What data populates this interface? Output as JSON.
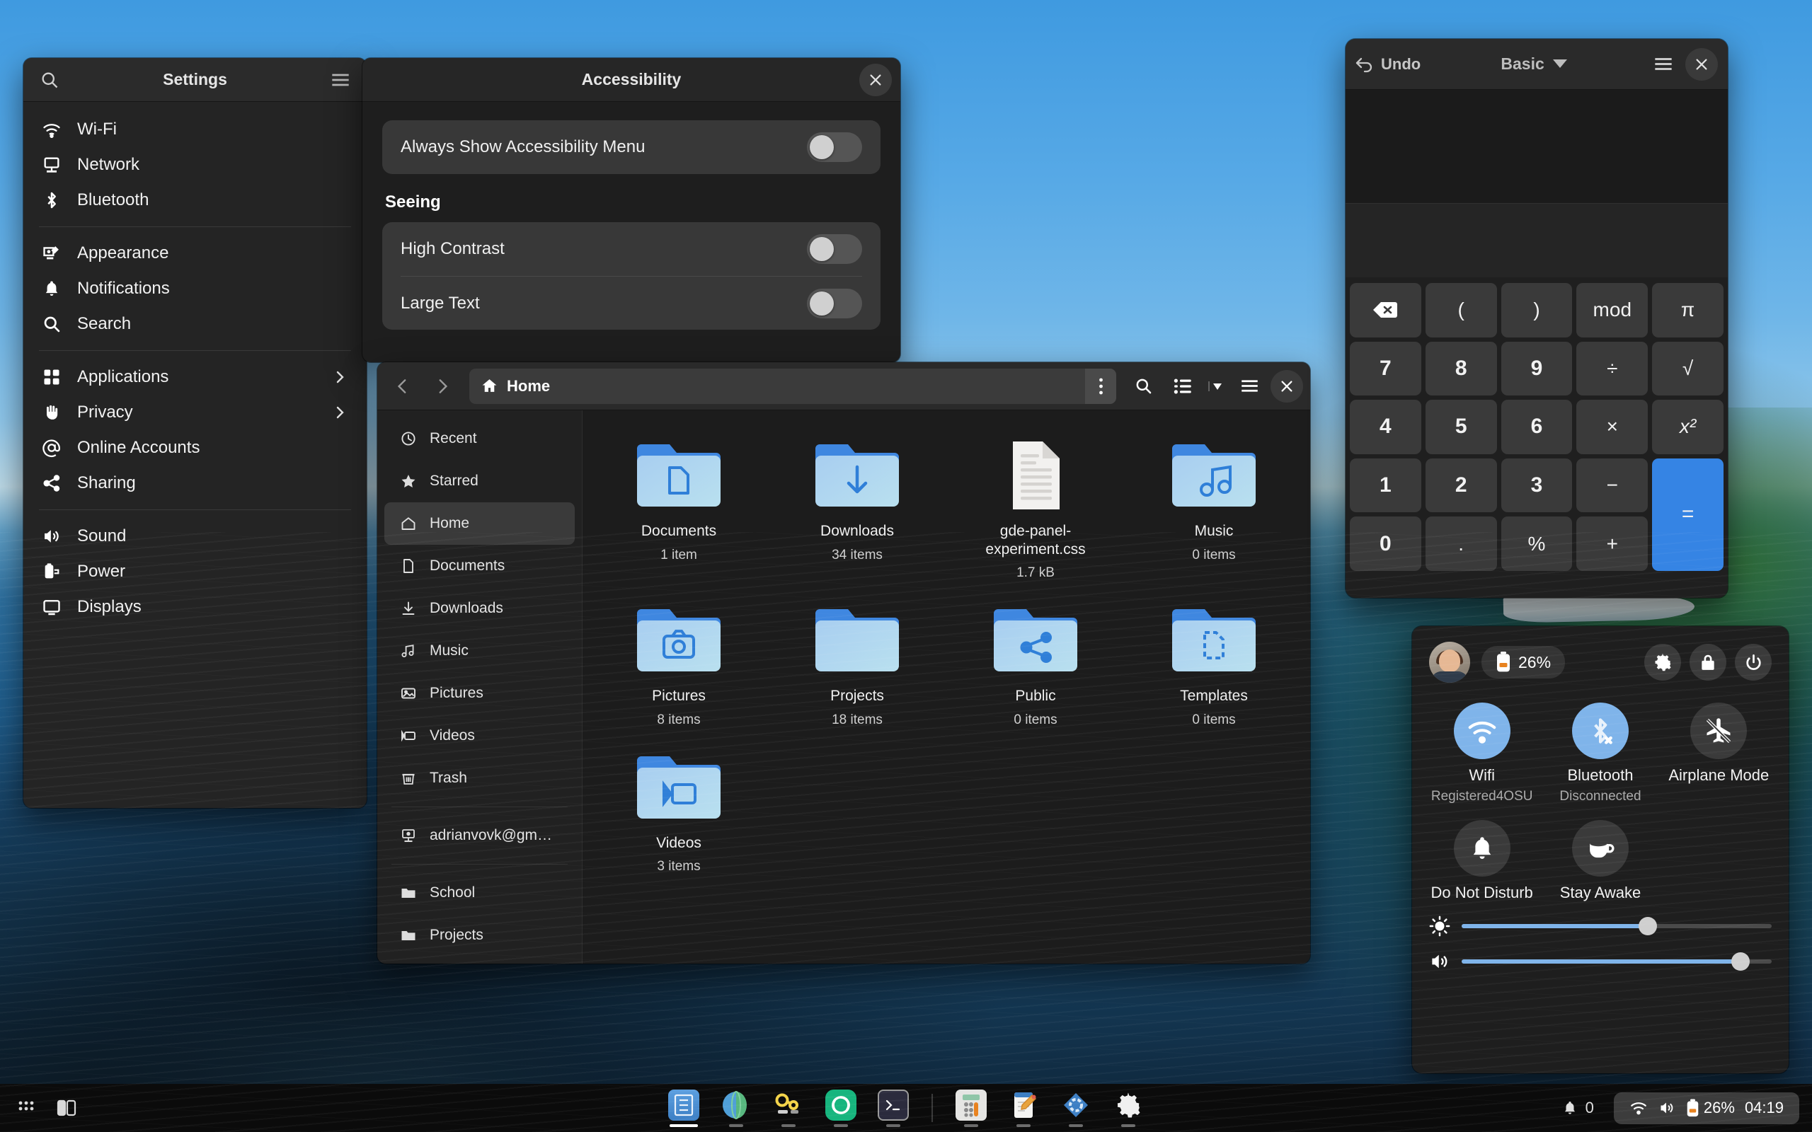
{
  "settings": {
    "title": "Settings",
    "search_icon": "search-icon",
    "menu_icon": "hamburger-menu-icon",
    "groups": [
      {
        "items": [
          {
            "label": "Wi-Fi",
            "icon": "wifi-icon"
          },
          {
            "label": "Network",
            "icon": "network-icon"
          },
          {
            "label": "Bluetooth",
            "icon": "bluetooth-icon"
          }
        ]
      },
      {
        "items": [
          {
            "label": "Appearance",
            "icon": "appearance-icon"
          },
          {
            "label": "Notifications",
            "icon": "bell-icon"
          },
          {
            "label": "Search",
            "icon": "search-icon"
          }
        ]
      },
      {
        "items": [
          {
            "label": "Applications",
            "icon": "applications-grid-icon",
            "chevron": "›"
          },
          {
            "label": "Privacy",
            "icon": "hand-icon",
            "chevron": "›"
          },
          {
            "label": "Online Accounts",
            "icon": "at-sign-icon"
          },
          {
            "label": "Sharing",
            "icon": "share-icon"
          }
        ]
      },
      {
        "items": [
          {
            "label": "Sound",
            "icon": "speaker-icon"
          },
          {
            "label": "Power",
            "icon": "battery-plug-icon"
          },
          {
            "label": "Displays",
            "icon": "display-icon"
          }
        ]
      }
    ]
  },
  "accessibility": {
    "title": "Accessibility",
    "close_icon": "close-icon",
    "rows_top": [
      {
        "label": "Always Show Accessibility Menu",
        "toggle": "off"
      }
    ],
    "section_seeing": "Seeing",
    "rows_seeing": [
      {
        "label": "High Contrast",
        "toggle": "off"
      },
      {
        "label": "Large Text",
        "toggle": "off"
      }
    ]
  },
  "files": {
    "back_icon": "chevron-left-icon",
    "forward_icon": "chevron-right-icon",
    "path_label": "Home",
    "path_icon": "home-icon",
    "path_menu_icon": "vertical-dots-icon",
    "search_icon": "search-icon",
    "view_list_icon": "list-view-icon",
    "view_dropdown_icon": "chevron-down-icon",
    "menu_icon": "hamburger-menu-icon",
    "close_icon": "close-icon",
    "sidebar": [
      {
        "label": "Recent",
        "icon": "clock-icon",
        "active": false
      },
      {
        "label": "Starred",
        "icon": "star-icon",
        "active": false
      },
      {
        "label": "Home",
        "icon": "home-icon",
        "active": true
      },
      {
        "label": "Documents",
        "icon": "document-icon",
        "active": false
      },
      {
        "label": "Downloads",
        "icon": "download-icon",
        "active": false
      },
      {
        "label": "Music",
        "icon": "music-note-icon",
        "active": false
      },
      {
        "label": "Pictures",
        "icon": "image-icon",
        "active": false
      },
      {
        "label": "Videos",
        "icon": "video-icon",
        "active": false
      },
      {
        "label": "Trash",
        "icon": "trash-icon",
        "active": false
      }
    ],
    "sidebar_account": [
      {
        "label": "adrianvovk@gm…",
        "icon": "computer-icon"
      }
    ],
    "sidebar_bookmarks": [
      {
        "label": "School",
        "icon": "folder-icon"
      },
      {
        "label": "Projects",
        "icon": "folder-icon"
      }
    ],
    "items": [
      {
        "name": "Documents",
        "sub": "1 item",
        "type": "folder",
        "glyph": "document"
      },
      {
        "name": "Downloads",
        "sub": "34 items",
        "type": "folder",
        "glyph": "download"
      },
      {
        "name": "gde-panel-experiment.css",
        "sub": "1.7 kB",
        "type": "file",
        "glyph": "text"
      },
      {
        "name": "Music",
        "sub": "0 items",
        "type": "folder",
        "glyph": "music"
      },
      {
        "name": "Pictures",
        "sub": "8 items",
        "type": "folder",
        "glyph": "camera"
      },
      {
        "name": "Projects",
        "sub": "18 items",
        "type": "folder",
        "glyph": "plain"
      },
      {
        "name": "Public",
        "sub": "0 items",
        "type": "folder",
        "glyph": "share"
      },
      {
        "name": "Templates",
        "sub": "0 items",
        "type": "folder",
        "glyph": "template"
      },
      {
        "name": "Videos",
        "sub": "3 items",
        "type": "folder",
        "glyph": "video"
      }
    ]
  },
  "calculator": {
    "undo_label": "Undo",
    "undo_icon": "undo-arrow-icon",
    "mode_label": "Basic",
    "mode_caret_icon": "chevron-down-icon",
    "menu_icon": "hamburger-menu-icon",
    "close_icon": "close-icon",
    "display_value": "",
    "keys": [
      {
        "label": "⌫",
        "kind": "icon",
        "name": "backspace"
      },
      {
        "label": "(",
        "kind": "op"
      },
      {
        "label": ")",
        "kind": "op"
      },
      {
        "label": "mod",
        "kind": "op"
      },
      {
        "label": "π",
        "kind": "op"
      },
      {
        "label": "7",
        "kind": "num"
      },
      {
        "label": "8",
        "kind": "num"
      },
      {
        "label": "9",
        "kind": "num"
      },
      {
        "label": "÷",
        "kind": "op"
      },
      {
        "label": "√",
        "kind": "op"
      },
      {
        "label": "4",
        "kind": "num"
      },
      {
        "label": "5",
        "kind": "num"
      },
      {
        "label": "6",
        "kind": "num"
      },
      {
        "label": "×",
        "kind": "op"
      },
      {
        "label": "x²",
        "kind": "op"
      },
      {
        "label": "1",
        "kind": "num"
      },
      {
        "label": "2",
        "kind": "num"
      },
      {
        "label": "3",
        "kind": "num"
      },
      {
        "label": "−",
        "kind": "op"
      },
      {
        "label": "=",
        "kind": "eq"
      },
      {
        "label": "0",
        "kind": "num"
      },
      {
        "label": ".",
        "kind": "op"
      },
      {
        "label": "%",
        "kind": "op"
      },
      {
        "label": "+",
        "kind": "op"
      }
    ],
    "accent": "#3584e4"
  },
  "quick_settings": {
    "avatar_name": "user-avatar",
    "battery_label": "26%",
    "battery_icon": "battery-icon",
    "settings_icon": "gear-icon",
    "lock_icon": "lock-icon",
    "power_icon": "power-icon",
    "tiles": [
      {
        "name": "Wifi",
        "sub": "Registered4OSU",
        "icon": "wifi-icon",
        "on": true
      },
      {
        "name": "Bluetooth",
        "sub": "Disconnected",
        "icon": "bluetooth-disconnected-icon",
        "on": true
      },
      {
        "name": "Airplane Mode",
        "sub": "",
        "icon": "airplane-off-icon",
        "on": false
      },
      {
        "name": "Do Not Disturb",
        "sub": "",
        "icon": "bell-icon",
        "on": false
      },
      {
        "name": "Stay Awake",
        "sub": "",
        "icon": "coffee-cup-icon",
        "on": false
      }
    ],
    "brightness": {
      "icon": "brightness-icon",
      "value": 60
    },
    "volume": {
      "icon": "volume-icon",
      "value": 90
    },
    "accent": "#7fb4ea"
  },
  "taskbar": {
    "apps_grid_icon": "apps-grid-icon",
    "workspaces_icon": "workspaces-icon",
    "apps": [
      {
        "name": "files-app",
        "active": true
      },
      {
        "name": "web-browser-app",
        "active": false
      },
      {
        "name": "builder-app",
        "active": false
      },
      {
        "name": "loupe-app",
        "active": false
      },
      {
        "name": "terminal-app",
        "active": false
      },
      {
        "name": "calculator-app",
        "active": false
      },
      {
        "name": "text-editor-app",
        "active": false
      },
      {
        "name": "extensions-app",
        "active": false
      },
      {
        "name": "settings-app",
        "active": false
      }
    ],
    "notification_count": "0",
    "notification_icon": "bell-icon",
    "status": {
      "wifi_icon": "wifi-icon",
      "volume_icon": "volume-icon",
      "battery_icon": "battery-icon",
      "battery_label": "26%",
      "clock": "04:19"
    }
  }
}
